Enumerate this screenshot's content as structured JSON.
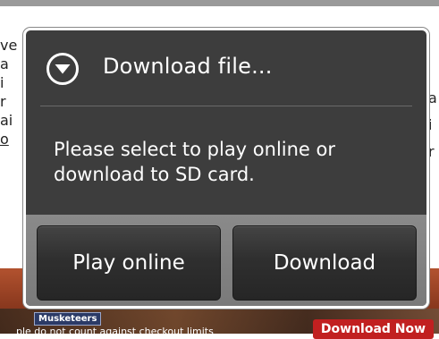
{
  "background": {
    "left_chars": [
      "ve",
      "a",
      "i",
      "r",
      "ai",
      "o"
    ],
    "right_chars": [
      "a",
      "i",
      "r"
    ],
    "musketeers_label": "Musketeers",
    "footer_text": "ple do not count against checkout limits",
    "download_now_label": "Download Now"
  },
  "dialog": {
    "icon": "chevron-down-circle-icon",
    "title": "Download file...",
    "message": "Please select to play online or download to SD card.",
    "buttons": {
      "play_online": "Play online",
      "download": "Download"
    }
  },
  "colors": {
    "dialog_bg": "#3d3d3d",
    "dialog_border": "#ffffff",
    "footer_bg": "#8a8a8a",
    "button_bg": "#2f2f2f",
    "download_now_bg": "#c12020"
  }
}
